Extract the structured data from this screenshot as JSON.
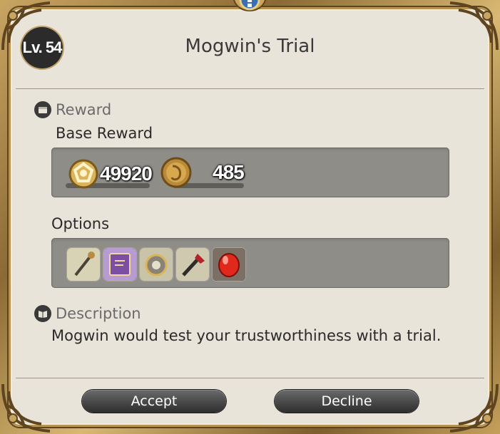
{
  "level_badge": "Lv. 54",
  "title": "Mogwin's Trial",
  "reward": {
    "header": "Reward",
    "base_reward_label": "Base Reward",
    "gil": "49920",
    "seals": "485",
    "options_label": "Options",
    "options": [
      {
        "icon": "scepter-icon"
      },
      {
        "icon": "grimoire-icon"
      },
      {
        "icon": "astrolabe-icon"
      },
      {
        "icon": "crossbow-icon"
      },
      {
        "icon": "red-gem-icon"
      }
    ]
  },
  "description": {
    "header": "Description",
    "text": "Mogwin would test your trustworthiness with a trial."
  },
  "buttons": {
    "accept": "Accept",
    "decline": "Decline"
  },
  "colors": {
    "frame_gold": "#c9a562",
    "panel": "#ebe7de",
    "slot_bar": "#8f8d88",
    "button": "#3a3a3a"
  }
}
